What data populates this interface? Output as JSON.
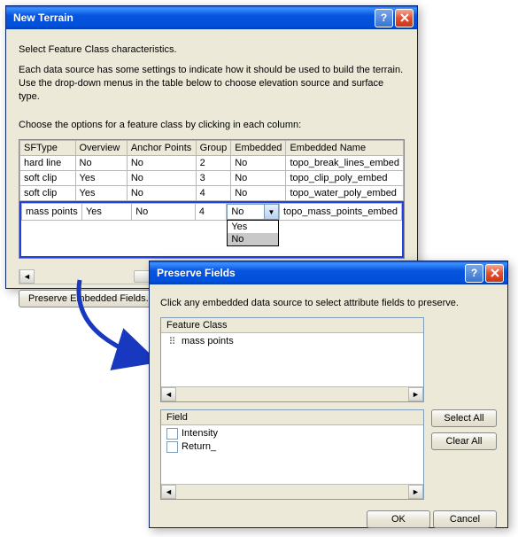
{
  "newTerrain": {
    "title": "New Terrain",
    "instr1": "Select Feature Class characteristics.",
    "instr2": "Each data source has some settings to indicate how it should be used to build the terrain.  Use the drop-down menus in the table below to choose elevation source and surface type.",
    "instr3": "Choose the options for a feature class by clicking in each column:",
    "columns": [
      "SFType",
      "Overview",
      "Anchor Points",
      "Group",
      "Embedded",
      "Embedded Name"
    ],
    "rows": [
      {
        "sftype": "hard line",
        "overview": "No",
        "anchor": "No",
        "group": "2",
        "embedded": "No",
        "ename": "topo_break_lines_embed"
      },
      {
        "sftype": "soft clip",
        "overview": "Yes",
        "anchor": "No",
        "group": "3",
        "embedded": "No",
        "ename": "topo_clip_poly_embed"
      },
      {
        "sftype": "soft clip",
        "overview": "Yes",
        "anchor": "No",
        "group": "4",
        "embedded": "No",
        "ename": "topo_water_poly_embed"
      }
    ],
    "hrow": {
      "sftype": "mass points",
      "overview": "Yes",
      "anchor": "No",
      "group": "4",
      "embedded": "No",
      "ename": "topo_mass_points_embed"
    },
    "dropdown": {
      "opt1": "Yes",
      "opt2": "No"
    },
    "preserveBtn": "Preserve Embedded Fields..."
  },
  "preserveFields": {
    "title": "Preserve Fields",
    "instr": "Click any embedded data source to select attribute fields to preserve.",
    "fcHeader": "Feature Class",
    "fcItem": "mass points",
    "fieldHeader": "Field",
    "fields": [
      "Intensity",
      "Return_"
    ],
    "selectAll": "Select All",
    "clearAll": "Clear All",
    "ok": "OK",
    "cancel": "Cancel"
  }
}
